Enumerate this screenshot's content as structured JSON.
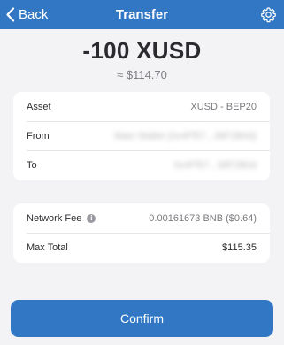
{
  "navbar": {
    "back_label": "Back",
    "title": "Transfer",
    "settings_icon": "gear-icon",
    "back_icon": "chevron-left-icon",
    "color": "#3277c3"
  },
  "summary": {
    "amount": "-100 XUSD",
    "fiat": "≈ $114.70"
  },
  "details": {
    "asset_label": "Asset",
    "asset_value": "XUSD - BEP20",
    "from_label": "From",
    "from_value": "Main Wallet (0x4Ff57...38F2B0d)",
    "to_label": "To",
    "to_value": "0x4Ff57...38F2B0d"
  },
  "fees": {
    "network_fee_label": "Network Fee",
    "network_fee_value": "0.00161673 BNB ($0.64)",
    "info_icon": "info-icon",
    "max_total_label": "Max Total",
    "max_total_value": "$115.35"
  },
  "actions": {
    "confirm_label": "Confirm"
  }
}
